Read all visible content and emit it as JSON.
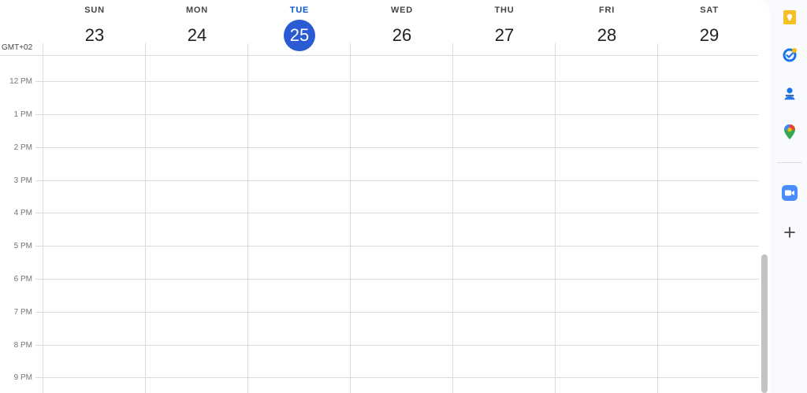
{
  "calendar": {
    "timezone": "GMT+02",
    "days": [
      {
        "dow": "SUN",
        "date": "23"
      },
      {
        "dow": "MON",
        "date": "24"
      },
      {
        "dow": "TUE",
        "date": "25"
      },
      {
        "dow": "WED",
        "date": "26"
      },
      {
        "dow": "THU",
        "date": "27"
      },
      {
        "dow": "FRI",
        "date": "28"
      },
      {
        "dow": "SAT",
        "date": "29"
      }
    ],
    "hours": [
      "12 PM",
      "1 PM",
      "2 PM",
      "3 PM",
      "4 PM",
      "5 PM",
      "6 PM",
      "7 PM",
      "8 PM",
      "9 PM"
    ]
  },
  "side_panel": {
    "icons": [
      "keep-icon",
      "tasks-icon",
      "contacts-icon",
      "maps-icon",
      "zoom-icon",
      "add-icon"
    ]
  },
  "colors": {
    "today_accent": "#2a5bd2",
    "today_label": "#0b57d0",
    "gridline": "#dadce0",
    "keep": "#f6bf26",
    "tasks": "#1a73e8",
    "zoom": "#4a8cff"
  }
}
